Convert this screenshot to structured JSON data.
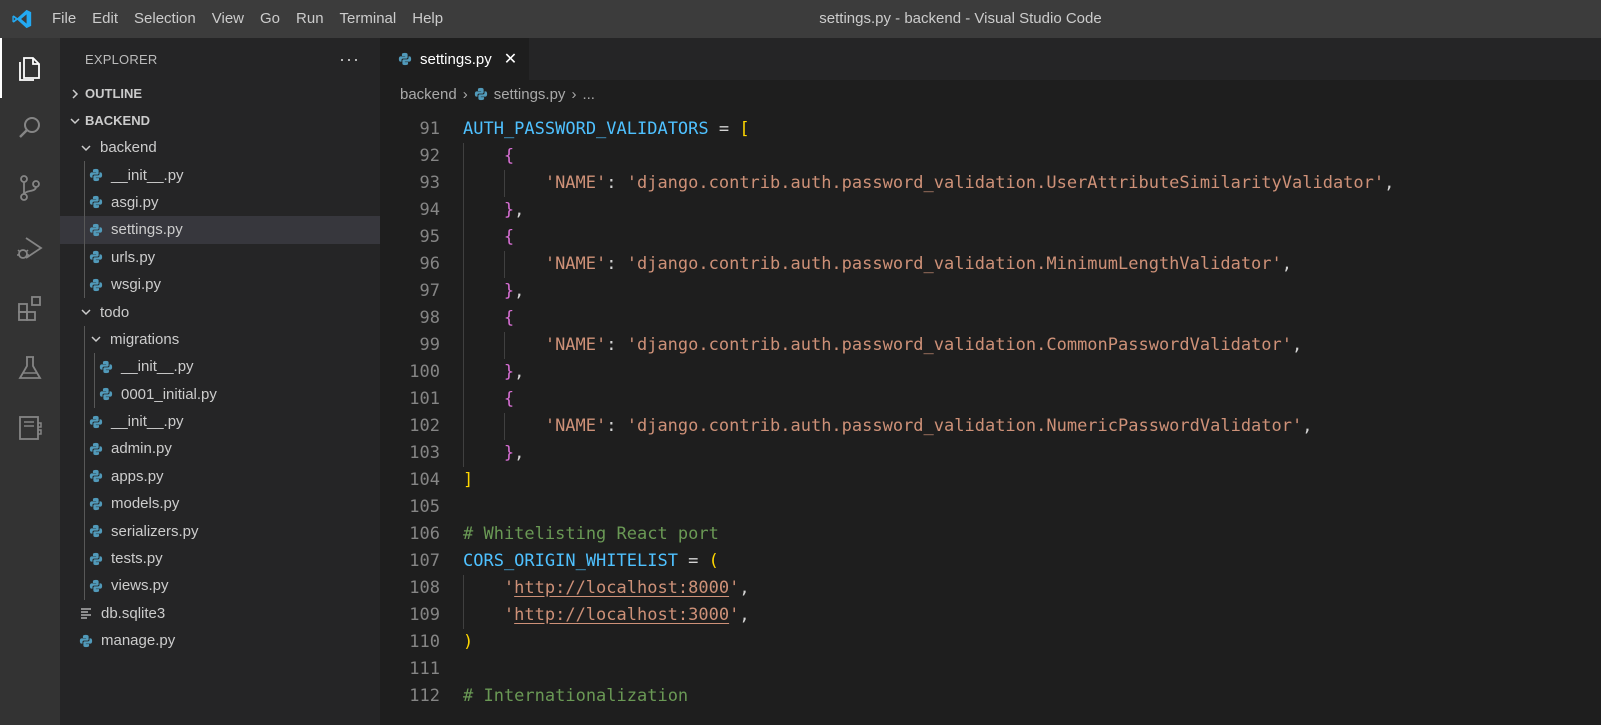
{
  "window": {
    "title": "settings.py - backend - Visual Studio Code"
  },
  "menu": [
    "File",
    "Edit",
    "Selection",
    "View",
    "Go",
    "Run",
    "Terminal",
    "Help"
  ],
  "activity_bar": [
    {
      "name": "explorer-icon",
      "active": true
    },
    {
      "name": "search-icon",
      "active": false
    },
    {
      "name": "source-control-icon",
      "active": false
    },
    {
      "name": "run-debug-icon",
      "active": false
    },
    {
      "name": "extensions-icon",
      "active": false
    },
    {
      "name": "testing-icon",
      "active": false
    },
    {
      "name": "notebook-icon",
      "active": false
    }
  ],
  "sidebar": {
    "title": "EXPLORER",
    "sections": {
      "outline": "OUTLINE",
      "project": "BACKEND"
    },
    "tree": [
      {
        "label": "backend",
        "kind": "folder",
        "depth": 1,
        "open": true
      },
      {
        "label": "__init__.py",
        "kind": "py",
        "depth": 2
      },
      {
        "label": "asgi.py",
        "kind": "py",
        "depth": 2
      },
      {
        "label": "settings.py",
        "kind": "py",
        "depth": 2,
        "selected": true
      },
      {
        "label": "urls.py",
        "kind": "py",
        "depth": 2
      },
      {
        "label": "wsgi.py",
        "kind": "py",
        "depth": 2
      },
      {
        "label": "todo",
        "kind": "folder",
        "depth": 1,
        "open": true
      },
      {
        "label": "migrations",
        "kind": "folder",
        "depth": 2,
        "open": true
      },
      {
        "label": "__init__.py",
        "kind": "py",
        "depth": 3
      },
      {
        "label": "0001_initial.py",
        "kind": "py",
        "depth": 3
      },
      {
        "label": "__init__.py",
        "kind": "py",
        "depth": 2
      },
      {
        "label": "admin.py",
        "kind": "py",
        "depth": 2
      },
      {
        "label": "apps.py",
        "kind": "py",
        "depth": 2
      },
      {
        "label": "models.py",
        "kind": "py",
        "depth": 2
      },
      {
        "label": "serializers.py",
        "kind": "py",
        "depth": 2
      },
      {
        "label": "tests.py",
        "kind": "py",
        "depth": 2
      },
      {
        "label": "views.py",
        "kind": "py",
        "depth": 2
      },
      {
        "label": "db.sqlite3",
        "kind": "file",
        "depth": 1
      },
      {
        "label": "manage.py",
        "kind": "py",
        "depth": 1
      }
    ]
  },
  "tabs": [
    {
      "label": "settings.py",
      "active": true
    }
  ],
  "breadcrumb": {
    "folder": "backend",
    "file": "settings.py",
    "more": "..."
  },
  "code_lines": [
    {
      "n": "91",
      "indent": 0,
      "tokens": [
        [
          "var",
          "AUTH_PASSWORD_VALIDATORS"
        ],
        [
          "op",
          " = "
        ],
        [
          "br1",
          "["
        ]
      ]
    },
    {
      "n": "92",
      "indent": 1,
      "tokens": [
        [
          "br2",
          "{"
        ]
      ]
    },
    {
      "n": "93",
      "indent": 2,
      "tokens": [
        [
          "str",
          "'NAME'"
        ],
        [
          "plain",
          ": "
        ],
        [
          "str",
          "'django.contrib.auth.password_validation.UserAttributeSimilarityValidator'"
        ],
        [
          "plain",
          ","
        ]
      ]
    },
    {
      "n": "94",
      "indent": 1,
      "tokens": [
        [
          "br2",
          "}"
        ],
        [
          "plain",
          ","
        ]
      ]
    },
    {
      "n": "95",
      "indent": 1,
      "tokens": [
        [
          "br2",
          "{"
        ]
      ]
    },
    {
      "n": "96",
      "indent": 2,
      "tokens": [
        [
          "str",
          "'NAME'"
        ],
        [
          "plain",
          ": "
        ],
        [
          "str",
          "'django.contrib.auth.password_validation.MinimumLengthValidator'"
        ],
        [
          "plain",
          ","
        ]
      ]
    },
    {
      "n": "97",
      "indent": 1,
      "tokens": [
        [
          "br2",
          "}"
        ],
        [
          "plain",
          ","
        ]
      ]
    },
    {
      "n": "98",
      "indent": 1,
      "tokens": [
        [
          "br2",
          "{"
        ]
      ]
    },
    {
      "n": "99",
      "indent": 2,
      "tokens": [
        [
          "str",
          "'NAME'"
        ],
        [
          "plain",
          ": "
        ],
        [
          "str",
          "'django.contrib.auth.password_validation.CommonPasswordValidator'"
        ],
        [
          "plain",
          ","
        ]
      ]
    },
    {
      "n": "100",
      "indent": 1,
      "tokens": [
        [
          "br2",
          "}"
        ],
        [
          "plain",
          ","
        ]
      ]
    },
    {
      "n": "101",
      "indent": 1,
      "tokens": [
        [
          "br2",
          "{"
        ]
      ]
    },
    {
      "n": "102",
      "indent": 2,
      "tokens": [
        [
          "str",
          "'NAME'"
        ],
        [
          "plain",
          ": "
        ],
        [
          "str",
          "'django.contrib.auth.password_validation.NumericPasswordValidator'"
        ],
        [
          "plain",
          ","
        ]
      ]
    },
    {
      "n": "103",
      "indent": 1,
      "tokens": [
        [
          "br2",
          "}"
        ],
        [
          "plain",
          ","
        ]
      ]
    },
    {
      "n": "104",
      "indent": 0,
      "tokens": [
        [
          "br1",
          "]"
        ]
      ]
    },
    {
      "n": "105",
      "indent": 0,
      "tokens": []
    },
    {
      "n": "106",
      "indent": 0,
      "tokens": [
        [
          "comment",
          "# Whitelisting React port"
        ]
      ]
    },
    {
      "n": "107",
      "indent": 0,
      "tokens": [
        [
          "var",
          "CORS_ORIGIN_WHITELIST"
        ],
        [
          "op",
          " = "
        ],
        [
          "br1",
          "("
        ]
      ]
    },
    {
      "n": "108",
      "indent": 1,
      "tokens": [
        [
          "str",
          "'"
        ],
        [
          "url",
          "http://localhost:8000"
        ],
        [
          "str",
          "'"
        ],
        [
          "plain",
          ","
        ]
      ]
    },
    {
      "n": "109",
      "indent": 1,
      "tokens": [
        [
          "str",
          "'"
        ],
        [
          "url",
          "http://localhost:3000"
        ],
        [
          "str",
          "'"
        ],
        [
          "plain",
          ","
        ]
      ]
    },
    {
      "n": "110",
      "indent": 0,
      "tokens": [
        [
          "br1",
          ")"
        ]
      ]
    },
    {
      "n": "111",
      "indent": 0,
      "tokens": []
    },
    {
      "n": "112",
      "indent": 0,
      "tokens": [
        [
          "comment",
          "# Internationalization"
        ]
      ]
    }
  ]
}
